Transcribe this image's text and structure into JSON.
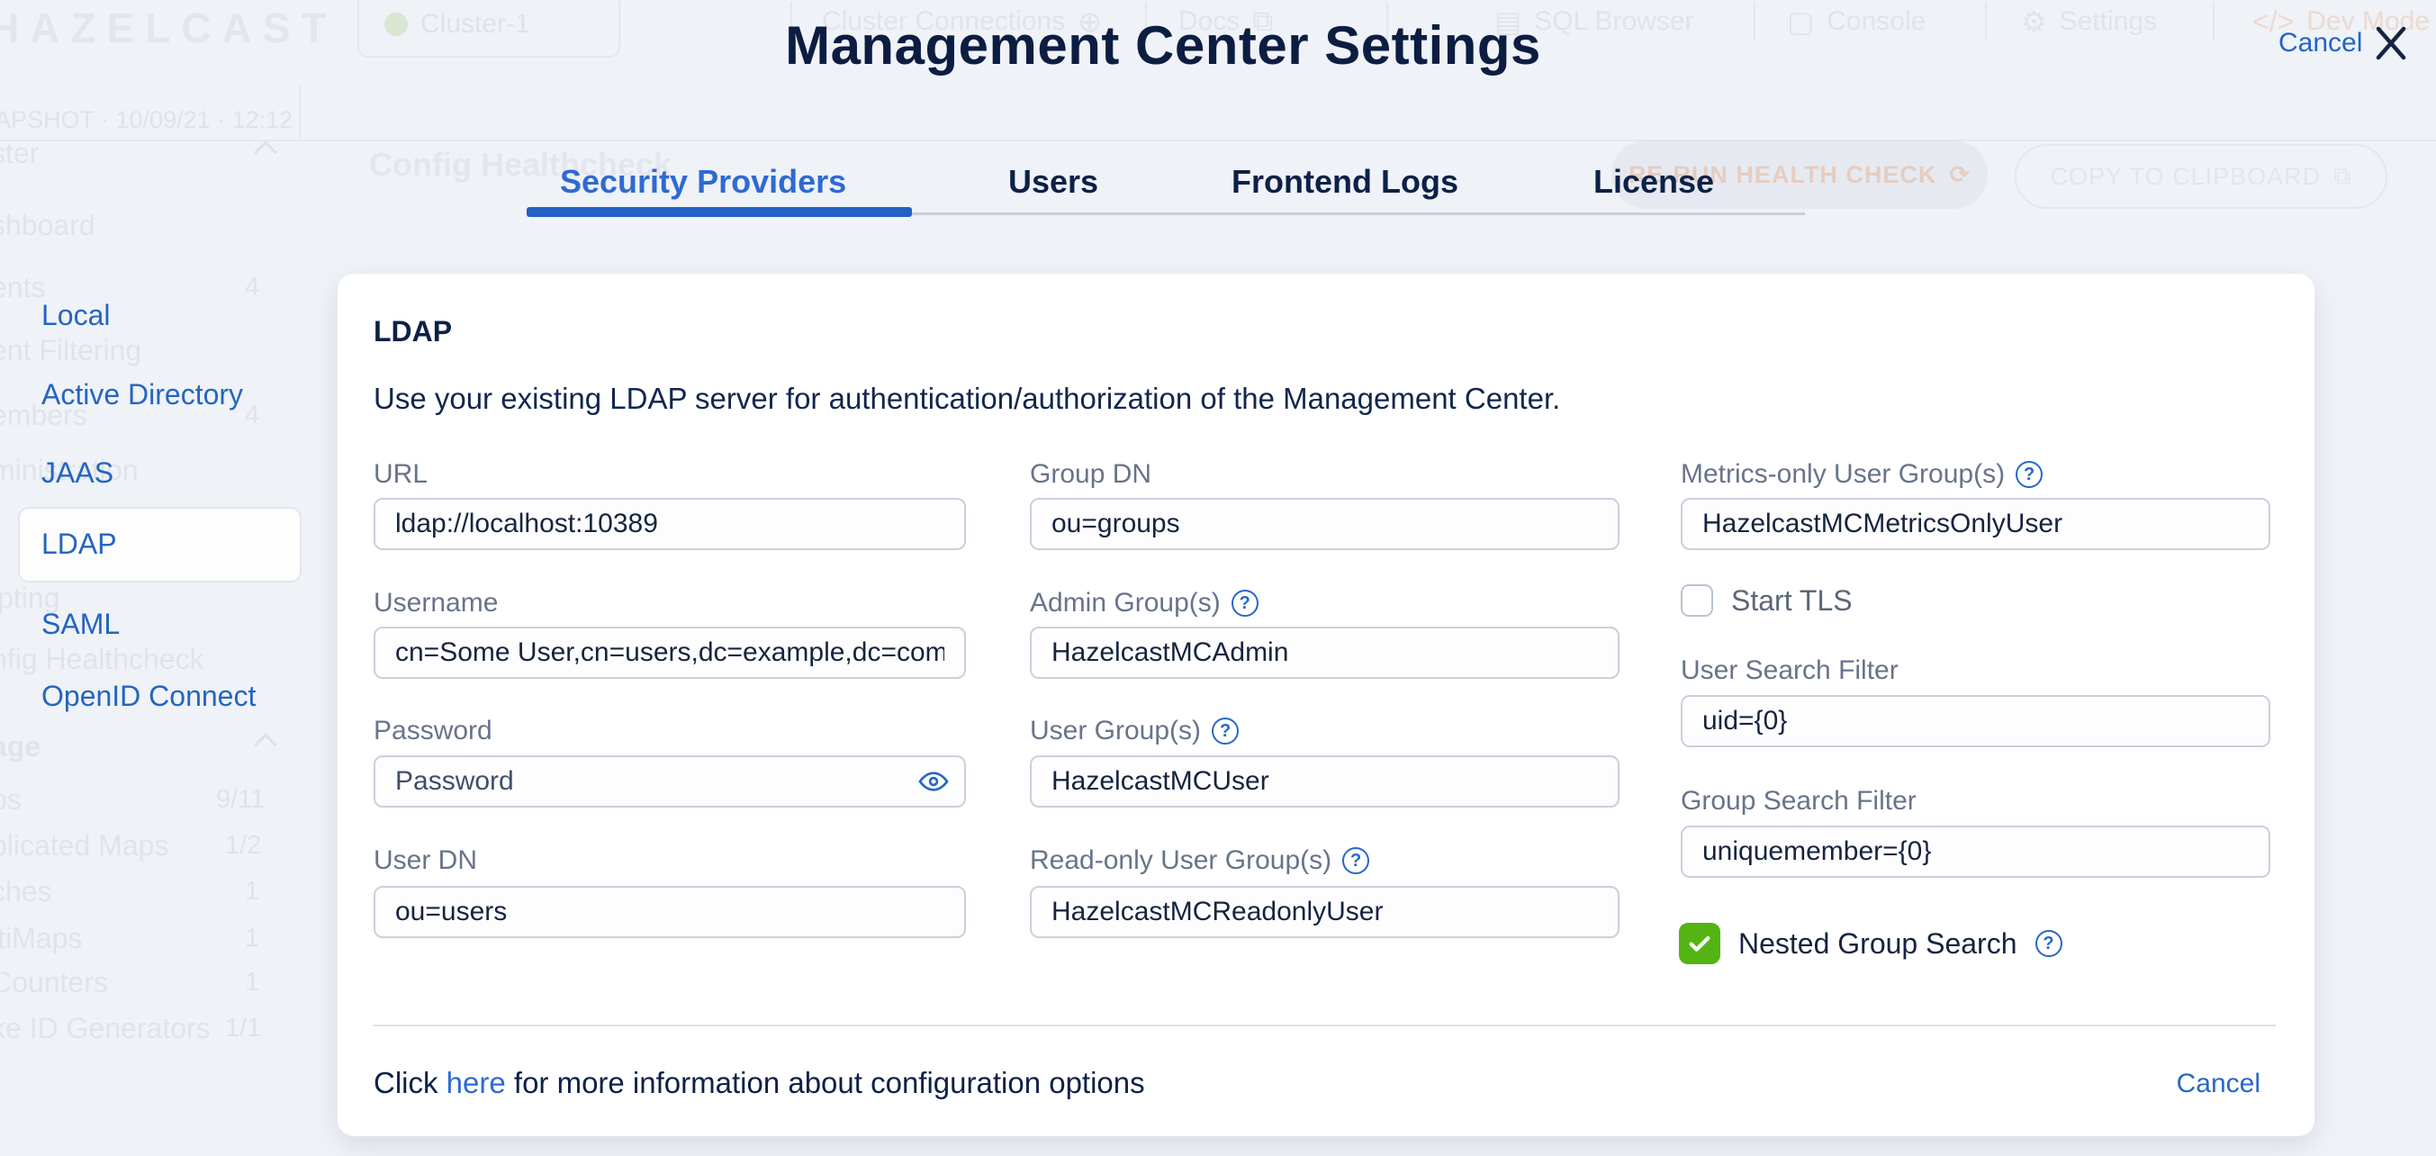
{
  "colors": {
    "navy": "#0d2148",
    "accent_blue": "#2767cb",
    "active_tab_blue": "#2e6ad1",
    "green_checkbox": "#55b414",
    "label_gray": "#67748b",
    "page_bg": "#eff2f7"
  },
  "icons": {
    "help": "?",
    "plus_circle": "⊕",
    "external_link": "⧉",
    "database": "▤",
    "document": "▢",
    "gear": "⚙",
    "code": "</>",
    "refresh": "⟳",
    "copy": "⧉"
  },
  "background": {
    "logo": "HAZELCAST",
    "cluster_chip": {
      "label": "Cluster-1"
    },
    "top_nav": [
      {
        "label": "Cluster Connections"
      },
      {
        "label": "Docs"
      },
      {
        "label": "SQL Browser"
      },
      {
        "label": "Console"
      },
      {
        "label": "Settings"
      },
      {
        "label": "Dev Mode"
      }
    ],
    "version_text": "APSHOT · 10/09/21 · 12:12",
    "page_title": "Config Healthcheck",
    "rerun_button": "RE-RUN HEALTH CHECK",
    "copy_button": "COPY TO CLIPBOARD",
    "sidebar_partial_items": [
      {
        "label": "ster",
        "badge": ""
      },
      {
        "label": "shboard",
        "badge": ""
      },
      {
        "label": "ents",
        "badge": "4"
      },
      {
        "label": "ent Filtering",
        "badge": ""
      },
      {
        "label": "embers",
        "badge": "4"
      },
      {
        "label": "ministration",
        "badge": ""
      },
      {
        "label": "ipting",
        "badge": ""
      },
      {
        "label": "nfig Healthcheck",
        "badge": ""
      },
      {
        "label": "age",
        "badge": ""
      },
      {
        "label": "ps",
        "badge": "9/11"
      },
      {
        "label": "plicated Maps",
        "badge": "1/2"
      },
      {
        "label": "ches",
        "badge": "1"
      },
      {
        "label": "ltiMaps",
        "badge": "1"
      },
      {
        "label": "Counters",
        "badge": "1"
      },
      {
        "label": "ke ID Generators",
        "badge": "1/1"
      }
    ]
  },
  "modal": {
    "title": "Management Center Settings",
    "cancel_label": "Cancel",
    "tabs": [
      {
        "label": "Security Providers",
        "active": true
      },
      {
        "label": "Users",
        "active": false
      },
      {
        "label": "Frontend Logs",
        "active": false
      },
      {
        "label": "License",
        "active": false
      }
    ],
    "sidebar": {
      "items": [
        {
          "label": "Local"
        },
        {
          "label": "Active Directory"
        },
        {
          "label": "JAAS"
        },
        {
          "label": "LDAP",
          "selected": true
        },
        {
          "label": "SAML"
        },
        {
          "label": "OpenID Connect"
        }
      ]
    },
    "panel": {
      "heading": "LDAP",
      "description": "Use your existing LDAP server for authentication/authorization of the Management Center.",
      "fields": {
        "url": {
          "label": "URL",
          "value": "ldap://localhost:10389"
        },
        "username": {
          "label": "Username",
          "value": "cn=Some User,cn=users,dc=example,dc=com"
        },
        "password": {
          "label": "Password",
          "placeholder": "Password"
        },
        "user_dn": {
          "label": "User DN",
          "value": "ou=users"
        },
        "group_dn": {
          "label": "Group DN",
          "value": "ou=groups"
        },
        "admin_groups": {
          "label": "Admin Group(s)",
          "value": "HazelcastMCAdmin"
        },
        "user_groups": {
          "label": "User Group(s)",
          "value": "HazelcastMCUser"
        },
        "readonly_groups": {
          "label": "Read-only User Group(s)",
          "value": "HazelcastMCReadonlyUser"
        },
        "metrics_groups": {
          "label": "Metrics-only User Group(s)",
          "value": "HazelcastMCMetricsOnlyUser"
        },
        "start_tls": {
          "label": "Start TLS",
          "checked": false
        },
        "user_search_filter": {
          "label": "User Search Filter",
          "value": "uid={0}"
        },
        "group_search_filter": {
          "label": "Group Search Filter",
          "value": "uniquemember={0}"
        },
        "nested_group_search": {
          "label": "Nested Group Search",
          "checked": true
        }
      },
      "footer": {
        "prefix": "Click ",
        "link": "here",
        "suffix": " for more information about configuration options",
        "cancel_label": "Cancel"
      }
    }
  }
}
